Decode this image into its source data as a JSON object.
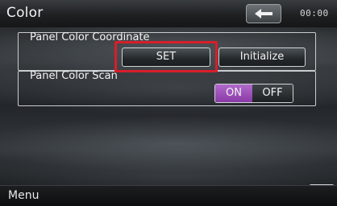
{
  "header": {
    "title": "Color",
    "clock": "00:00",
    "back_icon": "back-arrow-icon"
  },
  "panel_color_coordinate": {
    "label": "Panel Color Coordinate",
    "set_label": "SET",
    "initialize_label": "Initialize",
    "highlight_color": "#d81e2a"
  },
  "panel_color_scan": {
    "label": "Panel Color Scan",
    "on_label": "ON",
    "off_label": "OFF",
    "selected": "ON",
    "on_color": "#9b4fb8"
  },
  "footer": {
    "menu_label": "Menu",
    "return_icon": "return-icon"
  }
}
